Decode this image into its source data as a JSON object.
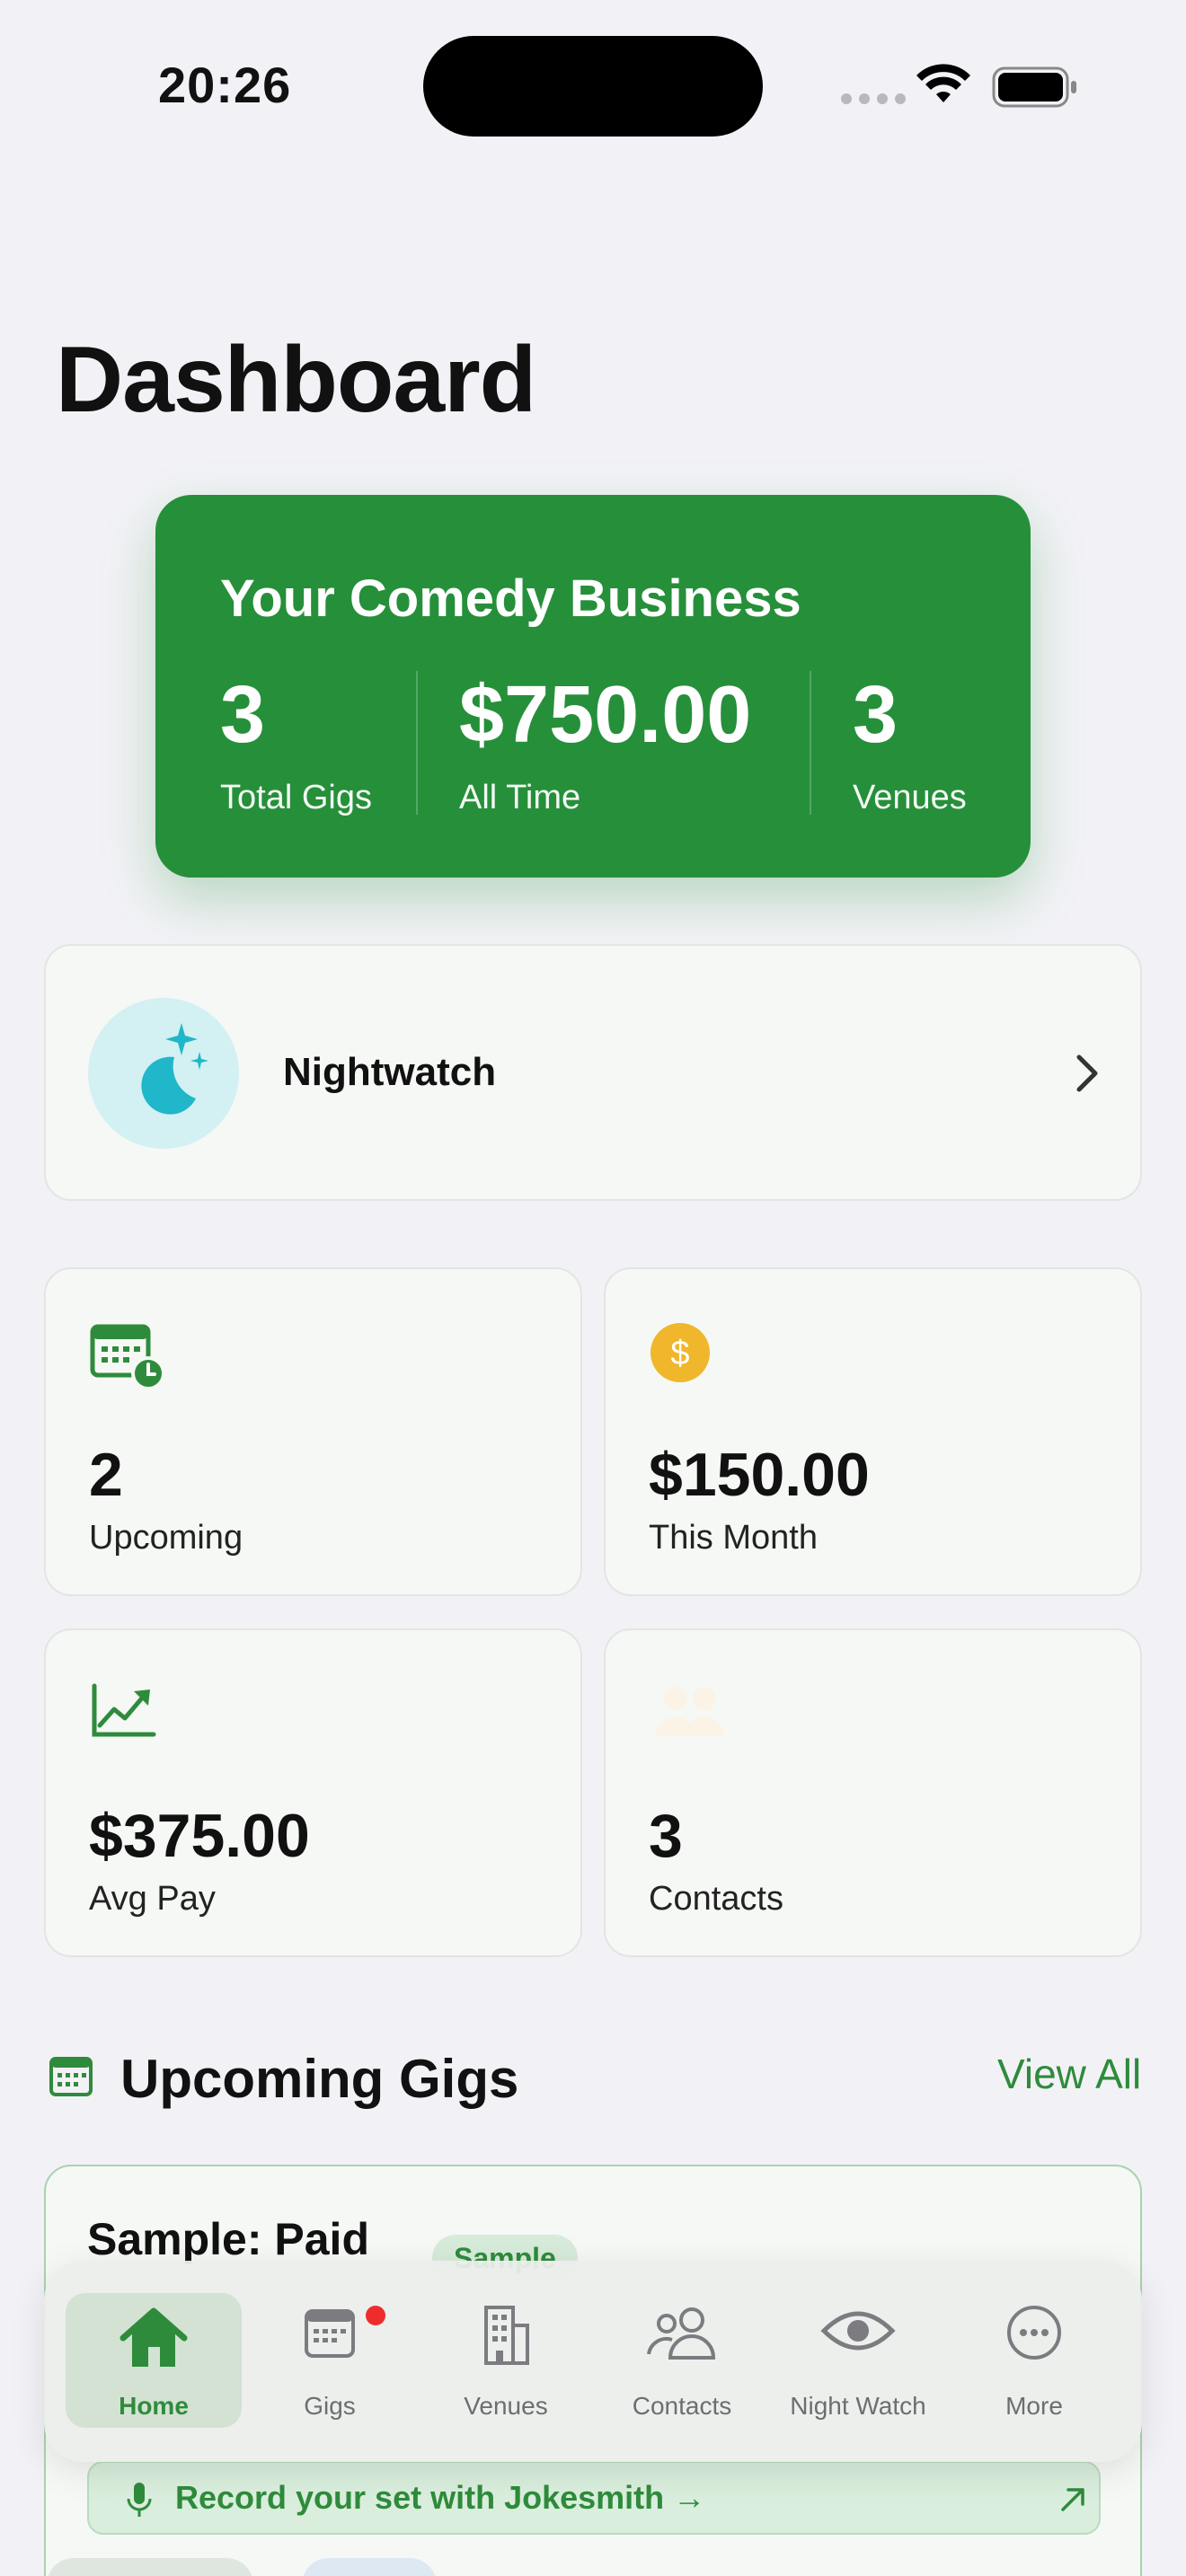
{
  "status_bar": {
    "time": "20:26"
  },
  "header": {
    "title": "Dashboard"
  },
  "hero": {
    "title": "Your Comedy Business",
    "stats": [
      {
        "value": "3",
        "label": "Total Gigs"
      },
      {
        "value": "$750.00",
        "label": "All Time"
      },
      {
        "value": "3",
        "label": "Venues"
      }
    ],
    "color": "#268f3a"
  },
  "nightwatch": {
    "label": "Nightwatch",
    "icon": "moon-stars-icon"
  },
  "stat_cards": [
    {
      "value": "2",
      "label": "Upcoming",
      "icon": "calendar-clock-icon"
    },
    {
      "value": "$150.00",
      "label": "This Month",
      "icon": "dollar-coin-icon"
    },
    {
      "value": "$375.00",
      "label": "Avg Pay",
      "icon": "trend-up-icon"
    },
    {
      "value": "3",
      "label": "Contacts",
      "icon": "people-icon"
    }
  ],
  "upcoming": {
    "title": "Upcoming Gigs",
    "view_all": "View All",
    "gig": {
      "title": "Sample: Paid",
      "badge": "Sample",
      "jokesmith": "Record your set with Jokesmith →"
    }
  },
  "tabbar": {
    "items": [
      {
        "label": "Home",
        "icon": "house-icon",
        "active": true
      },
      {
        "label": "Gigs",
        "icon": "calendar-icon"
      },
      {
        "label": "Venues",
        "icon": "building-icon"
      },
      {
        "label": "Contacts",
        "icon": "people-icon"
      },
      {
        "label": "Night Watch",
        "icon": "eye-icon"
      },
      {
        "label": "More",
        "icon": "ellipsis-circle-icon"
      }
    ]
  },
  "colors": {
    "accent": "#2f8b3c",
    "notification": "#ef2c2c"
  }
}
